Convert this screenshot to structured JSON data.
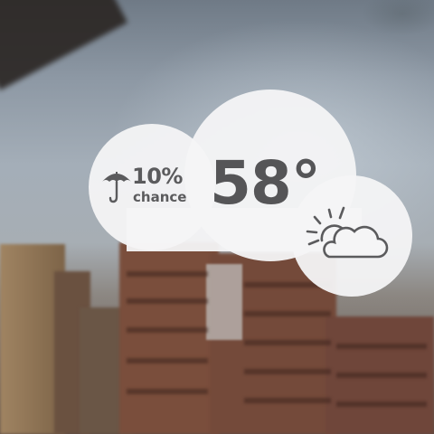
{
  "weather": {
    "precip_chance": "10%",
    "precip_label": "chance",
    "temperature": "58°",
    "precip_icon": "umbrella-icon",
    "condition_icon": "partly-cloudy-icon"
  },
  "colors": {
    "cloud_fill": "#f4f4f6",
    "text": "#5b5b5d"
  }
}
